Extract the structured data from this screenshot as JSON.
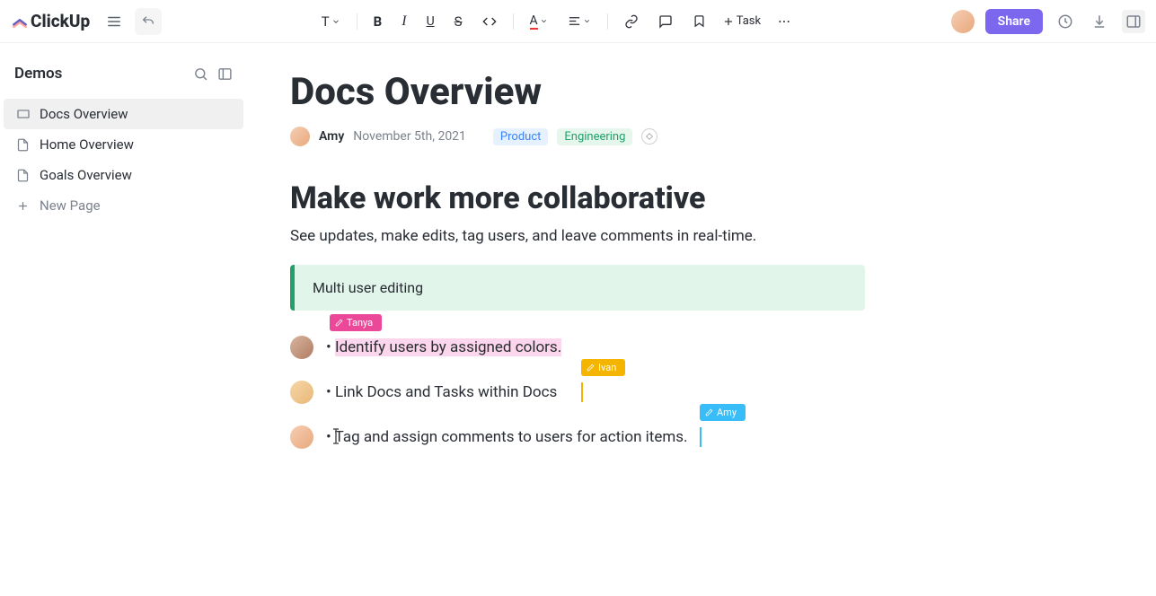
{
  "app_name": "ClickUp",
  "toolbar": {
    "text_style_label": "T",
    "task_label": "Task"
  },
  "share_label": "Share",
  "sidebar": {
    "title": "Demos",
    "items": [
      {
        "label": "Docs Overview",
        "icon": "doc",
        "active": true
      },
      {
        "label": "Home Overview",
        "icon": "doc",
        "active": false
      },
      {
        "label": "Goals Overview",
        "icon": "doc",
        "active": false
      }
    ],
    "new_page_label": "New Page"
  },
  "doc": {
    "title": "Docs Overview",
    "author": "Amy",
    "date": "November 5th, 2021",
    "tags": {
      "product": "Product",
      "engineering": "Engineering"
    },
    "h2": "Make work more collaborative",
    "paragraph": "See updates, make edits, tag users, and leave comments in real-time.",
    "callout": "Multi user editing",
    "bullets": [
      {
        "text": "Identify users by assigned colors.",
        "user": "Tanya"
      },
      {
        "text": "Link Docs and Tasks within Docs",
        "user": "Ivan"
      },
      {
        "text": "Tag and assign comments to users for action items.",
        "user": "Amy"
      }
    ],
    "cursor_labels": {
      "tanya": "Tanya",
      "ivan": "Ivan",
      "amy": "Amy"
    }
  }
}
